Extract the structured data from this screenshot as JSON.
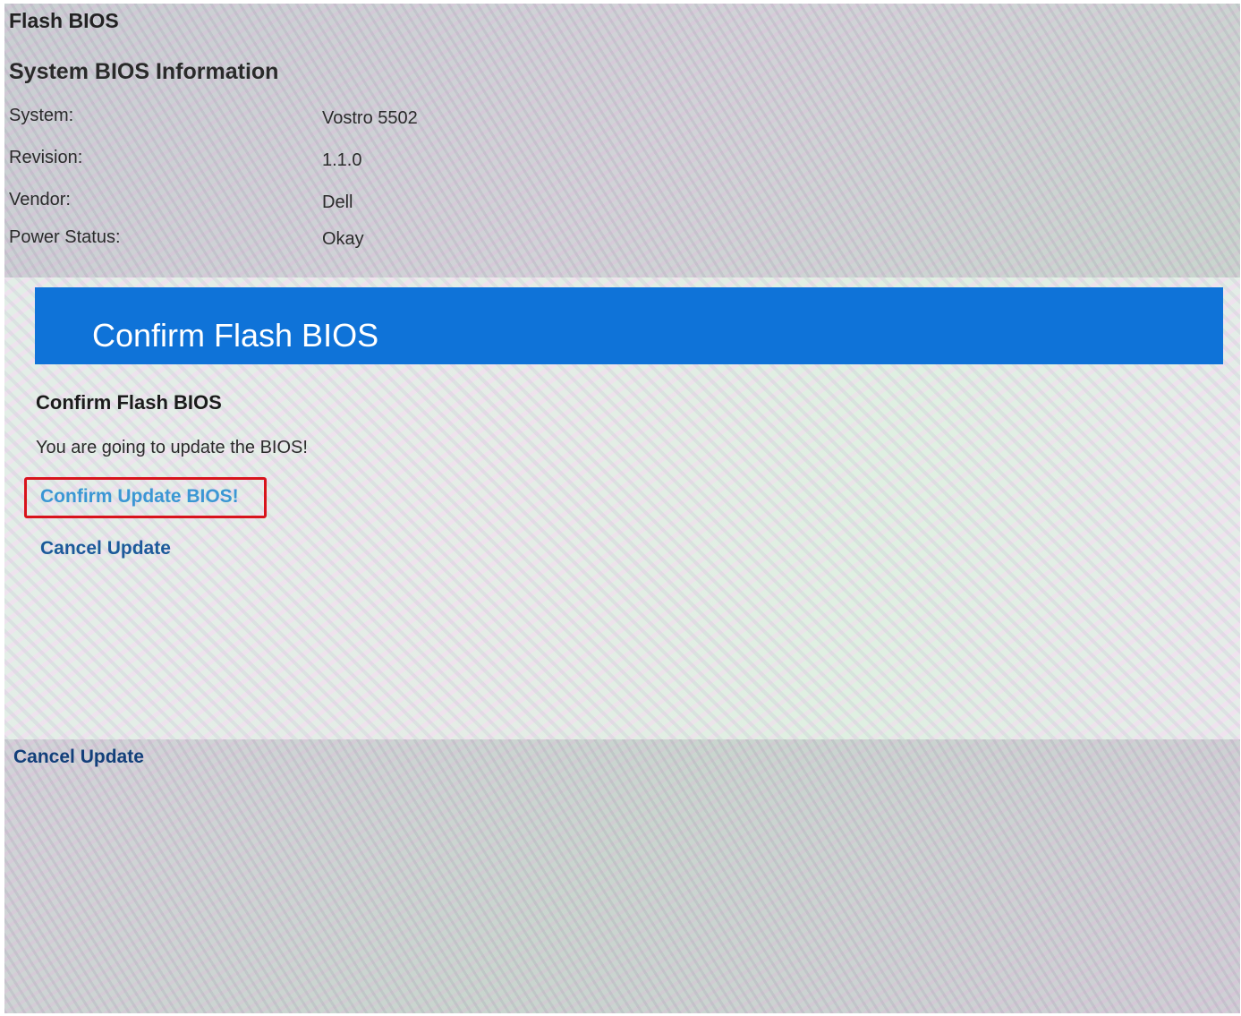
{
  "page": {
    "title": "Flash BIOS"
  },
  "system_info": {
    "heading": "System BIOS Information",
    "rows": [
      {
        "label": "System:",
        "value": "Vostro 5502"
      },
      {
        "label": "Revision:",
        "value": "1.1.0"
      },
      {
        "label": "Vendor:",
        "value": "Dell"
      },
      {
        "label": "Power Status:",
        "value": "Okay"
      }
    ]
  },
  "dialog": {
    "header_title": "Confirm Flash BIOS",
    "subtitle": "Confirm Flash BIOS",
    "message": "You are going to update the BIOS!",
    "confirm_label": "Confirm Update BIOS!",
    "cancel_label": "Cancel Update",
    "header_color": "#0f73d8",
    "highlight_color": "#d8141c"
  },
  "footer": {
    "cancel_label": "Cancel Update"
  }
}
